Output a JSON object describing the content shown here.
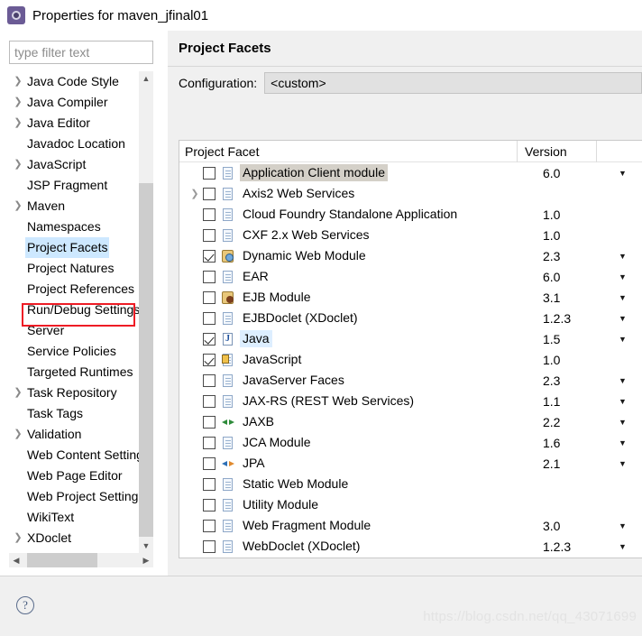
{
  "window": {
    "title": "Properties for maven_jfinal01",
    "icon": "gear-icon"
  },
  "filter": {
    "placeholder": "type filter text",
    "value": ""
  },
  "sidebar": {
    "items": [
      {
        "label": "Java Code Style",
        "expandable": true,
        "selected": false
      },
      {
        "label": "Java Compiler",
        "expandable": true,
        "selected": false
      },
      {
        "label": "Java Editor",
        "expandable": true,
        "selected": false
      },
      {
        "label": "Javadoc Location",
        "expandable": false,
        "selected": false
      },
      {
        "label": "JavaScript",
        "expandable": true,
        "selected": false
      },
      {
        "label": "JSP Fragment",
        "expandable": false,
        "selected": false
      },
      {
        "label": "Maven",
        "expandable": true,
        "selected": false
      },
      {
        "label": "Namespaces",
        "expandable": false,
        "selected": false
      },
      {
        "label": "Project Facets",
        "expandable": false,
        "selected": true
      },
      {
        "label": "Project Natures",
        "expandable": false,
        "selected": false
      },
      {
        "label": "Project References",
        "expandable": false,
        "selected": false
      },
      {
        "label": "Run/Debug Settings",
        "expandable": false,
        "selected": false
      },
      {
        "label": "Server",
        "expandable": false,
        "selected": false
      },
      {
        "label": "Service Policies",
        "expandable": false,
        "selected": false
      },
      {
        "label": "Targeted Runtimes",
        "expandable": false,
        "selected": false
      },
      {
        "label": "Task Repository",
        "expandable": true,
        "selected": false
      },
      {
        "label": "Task Tags",
        "expandable": false,
        "selected": false
      },
      {
        "label": "Validation",
        "expandable": true,
        "selected": false
      },
      {
        "label": "Web Content Settings",
        "expandable": false,
        "selected": false
      },
      {
        "label": "Web Page Editor",
        "expandable": false,
        "selected": false
      },
      {
        "label": "Web Project Settings",
        "expandable": false,
        "selected": false
      },
      {
        "label": "WikiText",
        "expandable": false,
        "selected": false
      },
      {
        "label": "XDoclet",
        "expandable": true,
        "selected": false
      }
    ],
    "scroll_up_icon": "chevron-up-icon",
    "scroll_down_icon": "chevron-down-icon",
    "scroll_left_icon": "chevron-left-icon",
    "scroll_right_icon": "chevron-right-icon",
    "highlight_color": "#ee1c25"
  },
  "page": {
    "title": "Project Facets",
    "configuration_label": "Configuration:",
    "configuration_value": "<custom>"
  },
  "table": {
    "columns": [
      "Project Facet",
      "Version"
    ],
    "rows": [
      {
        "name": "Application Client module",
        "version": "6.0",
        "checked": false,
        "expandable": false,
        "icon": "document-icon",
        "state": "hover",
        "has_dropdown": true
      },
      {
        "name": "Axis2 Web Services",
        "version": "",
        "checked": false,
        "expandable": true,
        "icon": "document-icon",
        "state": "normal",
        "has_dropdown": false
      },
      {
        "name": "Cloud Foundry Standalone Application",
        "version": "1.0",
        "checked": false,
        "expandable": false,
        "icon": "document-icon",
        "state": "normal",
        "has_dropdown": false
      },
      {
        "name": "CXF 2.x Web Services",
        "version": "1.0",
        "checked": false,
        "expandable": false,
        "icon": "document-icon",
        "state": "normal",
        "has_dropdown": false
      },
      {
        "name": "Dynamic Web Module",
        "version": "2.3",
        "checked": true,
        "expandable": false,
        "icon": "web-module-icon",
        "state": "normal",
        "has_dropdown": true
      },
      {
        "name": "EAR",
        "version": "6.0",
        "checked": false,
        "expandable": false,
        "icon": "document-icon",
        "state": "normal",
        "has_dropdown": true
      },
      {
        "name": "EJB Module",
        "version": "3.1",
        "checked": false,
        "expandable": false,
        "icon": "ejb-module-icon",
        "state": "normal",
        "has_dropdown": true
      },
      {
        "name": "EJBDoclet (XDoclet)",
        "version": "1.2.3",
        "checked": false,
        "expandable": false,
        "icon": "document-icon",
        "state": "normal",
        "has_dropdown": true
      },
      {
        "name": "Java",
        "version": "1.5",
        "checked": true,
        "expandable": false,
        "icon": "java-icon",
        "state": "selected",
        "has_dropdown": true
      },
      {
        "name": "JavaScript",
        "version": "1.0",
        "checked": true,
        "expandable": false,
        "icon": "javascript-icon",
        "state": "normal",
        "has_dropdown": false
      },
      {
        "name": "JavaServer Faces",
        "version": "2.3",
        "checked": false,
        "expandable": false,
        "icon": "document-icon",
        "state": "normal",
        "has_dropdown": true
      },
      {
        "name": "JAX-RS (REST Web Services)",
        "version": "1.1",
        "checked": false,
        "expandable": false,
        "icon": "document-icon",
        "state": "normal",
        "has_dropdown": true
      },
      {
        "name": "JAXB",
        "version": "2.2",
        "checked": false,
        "expandable": false,
        "icon": "jaxb-icon",
        "state": "normal",
        "has_dropdown": true
      },
      {
        "name": "JCA Module",
        "version": "1.6",
        "checked": false,
        "expandable": false,
        "icon": "document-icon",
        "state": "normal",
        "has_dropdown": true
      },
      {
        "name": "JPA",
        "version": "2.1",
        "checked": false,
        "expandable": false,
        "icon": "jpa-icon",
        "state": "normal",
        "has_dropdown": true
      },
      {
        "name": "Static Web Module",
        "version": "",
        "checked": false,
        "expandable": false,
        "icon": "document-icon",
        "state": "normal",
        "has_dropdown": false
      },
      {
        "name": "Utility Module",
        "version": "",
        "checked": false,
        "expandable": false,
        "icon": "document-icon",
        "state": "normal",
        "has_dropdown": false
      },
      {
        "name": "Web Fragment Module",
        "version": "3.0",
        "checked": false,
        "expandable": false,
        "icon": "document-icon",
        "state": "normal",
        "has_dropdown": true
      },
      {
        "name": "WebDoclet (XDoclet)",
        "version": "1.2.3",
        "checked": false,
        "expandable": false,
        "icon": "document-icon",
        "state": "normal",
        "has_dropdown": true
      }
    ]
  },
  "footer": {
    "help_icon": "help-question-icon",
    "watermark": "https://blog.csdn.net/qq_43071699"
  }
}
